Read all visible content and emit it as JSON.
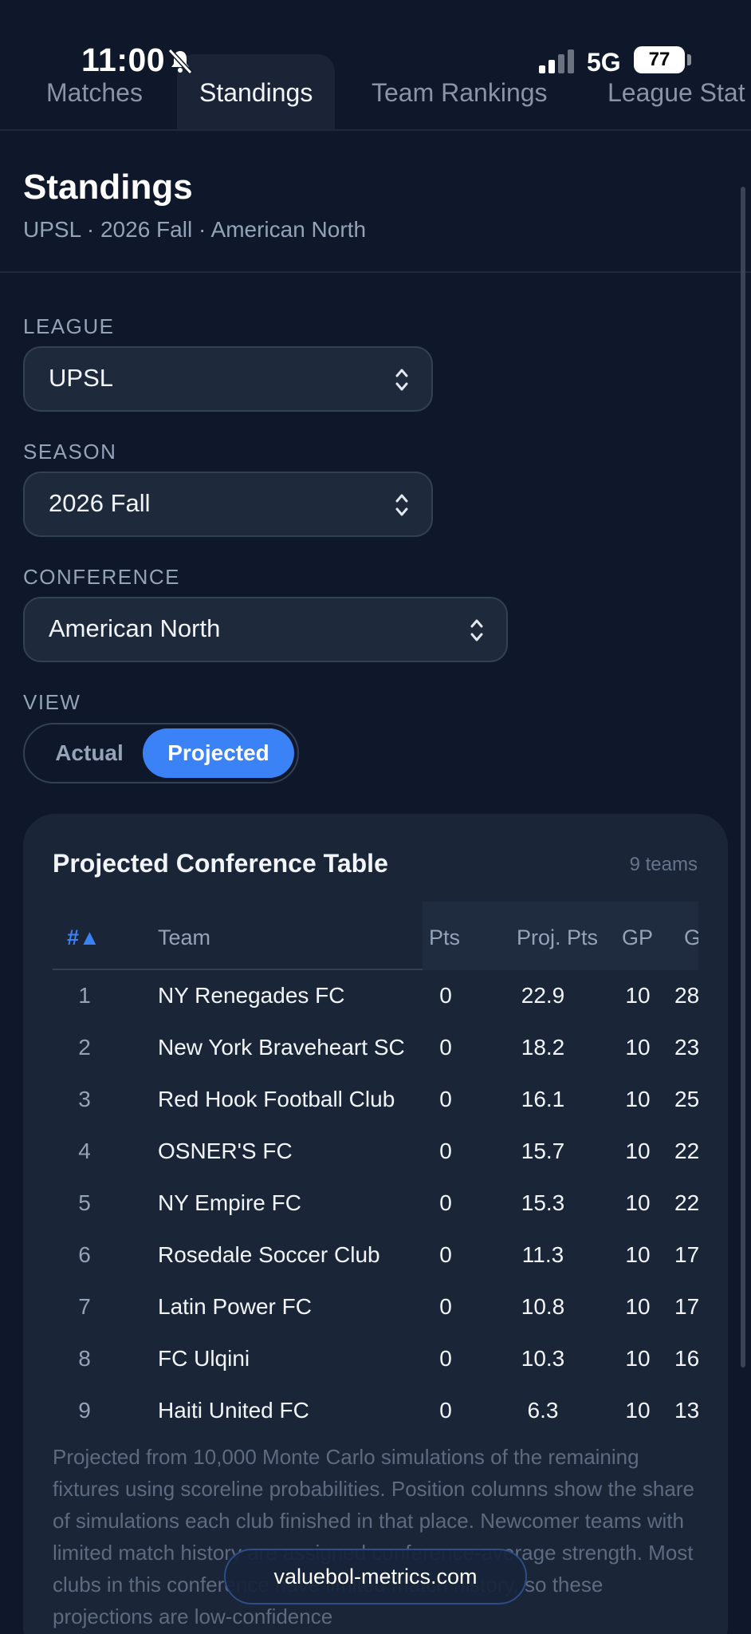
{
  "status_bar": {
    "time": "11:00",
    "network": "5G",
    "battery": "77"
  },
  "tabs": [
    {
      "label": "Matches"
    },
    {
      "label": "Standings"
    },
    {
      "label": "Team Rankings"
    },
    {
      "label": "League Stat"
    }
  ],
  "header": {
    "title": "Standings",
    "subtitle": "UPSL · 2026 Fall · American North"
  },
  "filters": {
    "league": {
      "label": "LEAGUE",
      "value": "UPSL"
    },
    "season": {
      "label": "SEASON",
      "value": "2026 Fall"
    },
    "conference": {
      "label": "CONFERENCE",
      "value": "American North"
    },
    "view": {
      "label": "VIEW",
      "options": [
        "Actual",
        "Projected"
      ],
      "selected": "Projected"
    }
  },
  "card": {
    "title": "Projected Conference Table",
    "count": "9 teams",
    "columns": [
      "#▲",
      "Team",
      "Pts",
      "Proj. Pts",
      "GP",
      "G"
    ],
    "rows": [
      {
        "rank": "1",
        "team": "NY Renegades FC",
        "pts": "0",
        "proj": "22.9",
        "gp": "10",
        "g": "28"
      },
      {
        "rank": "2",
        "team": "New York Braveheart SC",
        "pts": "0",
        "proj": "18.2",
        "gp": "10",
        "g": "23"
      },
      {
        "rank": "3",
        "team": "Red Hook Football Club",
        "pts": "0",
        "proj": "16.1",
        "gp": "10",
        "g": "25"
      },
      {
        "rank": "4",
        "team": "OSNER'S FC",
        "pts": "0",
        "proj": "15.7",
        "gp": "10",
        "g": "22"
      },
      {
        "rank": "5",
        "team": "NY Empire FC",
        "pts": "0",
        "proj": "15.3",
        "gp": "10",
        "g": "22"
      },
      {
        "rank": "6",
        "team": "Rosedale Soccer Club",
        "pts": "0",
        "proj": "11.3",
        "gp": "10",
        "g": "17"
      },
      {
        "rank": "7",
        "team": "Latin Power FC",
        "pts": "0",
        "proj": "10.8",
        "gp": "10",
        "g": "17"
      },
      {
        "rank": "8",
        "team": "FC Ulqini",
        "pts": "0",
        "proj": "10.3",
        "gp": "10",
        "g": "16"
      },
      {
        "rank": "9",
        "team": "Haiti United FC",
        "pts": "0",
        "proj": "6.3",
        "gp": "10",
        "g": "13"
      }
    ],
    "footnote": "Projected from 10,000 Monte Carlo simulations of the remaining fixtures using scoreline probabilities. Position columns show the share of simulations each club finished in that place. Newcomer teams with limited match history are assigned conference-average strength. Most clubs in this conference have limited match history, so these projections are low-confidence"
  },
  "watermark": "valuebol-metrics.com",
  "colors": {
    "accent": "#3b82f6",
    "background": "#0f172a",
    "card": "#1a2538"
  }
}
